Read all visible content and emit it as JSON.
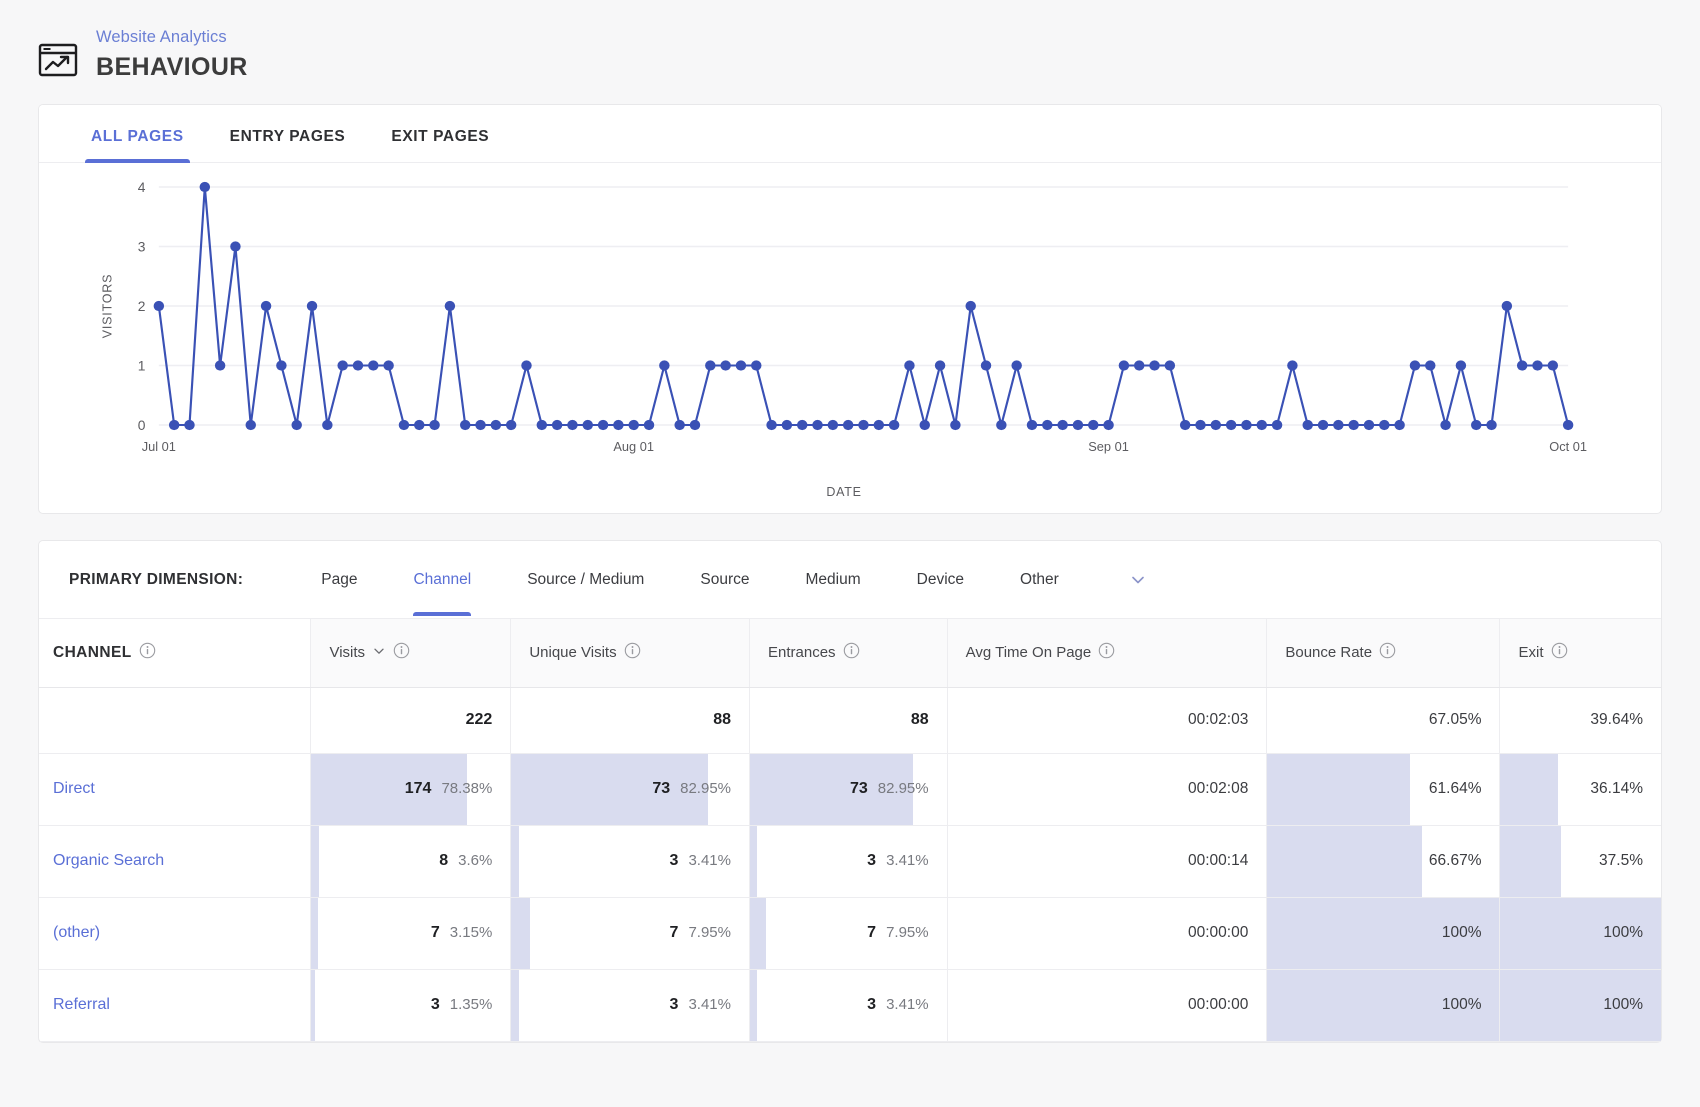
{
  "header": {
    "breadcrumb": "Website Analytics",
    "title": "BEHAVIOUR",
    "icon": "analytics-window-icon"
  },
  "tabs": [
    {
      "label": "ALL PAGES",
      "active": true
    },
    {
      "label": "ENTRY PAGES",
      "active": false
    },
    {
      "label": "EXIT PAGES",
      "active": false
    }
  ],
  "colors": {
    "accent": "#5a6fd6",
    "series": "#3a51b5",
    "fill": "#d9dcef",
    "grid": "#eeeef2",
    "text": "#3b3c40"
  },
  "chart_data": {
    "type": "line",
    "title": "",
    "xlabel": "DATE",
    "ylabel": "VISITORS",
    "ylim": [
      0,
      4
    ],
    "yticks": [
      0,
      1,
      2,
      3,
      4
    ],
    "grid": true,
    "legend": "none",
    "markers": true,
    "xtick_labels": [
      "Jul 01",
      "Aug 01",
      "Sep 01",
      "Oct 01"
    ],
    "xtick_index": [
      0,
      31,
      62,
      92
    ],
    "x": [
      "Jul 01",
      "Jul 02",
      "Jul 03",
      "Jul 04",
      "Jul 05",
      "Jul 06",
      "Jul 07",
      "Jul 08",
      "Jul 09",
      "Jul 10",
      "Jul 11",
      "Jul 12",
      "Jul 13",
      "Jul 14",
      "Jul 15",
      "Jul 16",
      "Jul 17",
      "Jul 18",
      "Jul 19",
      "Jul 20",
      "Jul 21",
      "Jul 22",
      "Jul 23",
      "Jul 24",
      "Jul 25",
      "Jul 26",
      "Jul 27",
      "Jul 28",
      "Jul 29",
      "Jul 30",
      "Jul 31",
      "Aug 01",
      "Aug 02",
      "Aug 03",
      "Aug 04",
      "Aug 05",
      "Aug 06",
      "Aug 07",
      "Aug 08",
      "Aug 09",
      "Aug 10",
      "Aug 11",
      "Aug 12",
      "Aug 13",
      "Aug 14",
      "Aug 15",
      "Aug 16",
      "Aug 17",
      "Aug 18",
      "Aug 19",
      "Aug 20",
      "Aug 21",
      "Aug 22",
      "Aug 23",
      "Aug 24",
      "Aug 25",
      "Aug 26",
      "Aug 27",
      "Aug 28",
      "Aug 29",
      "Aug 30",
      "Aug 31",
      "Sep 01",
      "Sep 02",
      "Sep 03",
      "Sep 04",
      "Sep 05",
      "Sep 06",
      "Sep 07",
      "Sep 08",
      "Sep 09",
      "Sep 10",
      "Sep 11",
      "Sep 12",
      "Sep 13",
      "Sep 14",
      "Sep 15",
      "Sep 16",
      "Sep 17",
      "Sep 18",
      "Sep 19",
      "Sep 20",
      "Sep 21",
      "Sep 22",
      "Sep 23",
      "Sep 24",
      "Sep 25",
      "Sep 26",
      "Sep 27",
      "Sep 28",
      "Sep 29",
      "Sep 30",
      "Oct 01"
    ],
    "series": [
      {
        "name": "Visitors",
        "values": [
          2,
          0,
          0,
          4,
          1,
          3,
          0,
          2,
          1,
          0,
          2,
          0,
          1,
          1,
          1,
          1,
          0,
          0,
          0,
          2,
          0,
          0,
          0,
          0,
          1,
          0,
          0,
          0,
          0,
          0,
          0,
          0,
          0,
          1,
          0,
          0,
          1,
          1,
          1,
          1,
          0,
          0,
          0,
          0,
          0,
          0,
          0,
          0,
          0,
          1,
          0,
          1,
          0,
          2,
          1,
          0,
          1,
          0,
          0,
          0,
          0,
          0,
          0,
          1,
          1,
          1,
          1,
          0,
          0,
          0,
          0,
          0,
          0,
          0,
          1,
          0,
          0,
          0,
          0,
          0,
          0,
          0,
          1,
          1,
          0,
          1,
          0,
          0,
          2,
          1,
          1,
          1,
          0
        ]
      }
    ]
  },
  "primary_dimension": {
    "label": "PRIMARY DIMENSION:",
    "options": [
      {
        "label": "Page",
        "active": false
      },
      {
        "label": "Channel",
        "active": true
      },
      {
        "label": "Source / Medium",
        "active": false
      },
      {
        "label": "Source",
        "active": false
      },
      {
        "label": "Medium",
        "active": false
      },
      {
        "label": "Device",
        "active": false
      },
      {
        "label": "Other",
        "active": false
      }
    ],
    "chevron_icon": "chevron-down-icon"
  },
  "table": {
    "columns": [
      {
        "label": "CHANNEL",
        "info": true,
        "sortable": false
      },
      {
        "label": "Visits",
        "info": true,
        "sortable": true
      },
      {
        "label": "Unique Visits",
        "info": true,
        "sortable": false
      },
      {
        "label": "Entrances",
        "info": true,
        "sortable": false
      },
      {
        "label": "Avg Time On Page",
        "info": true,
        "sortable": false
      },
      {
        "label": "Bounce Rate",
        "info": true,
        "sortable": false
      },
      {
        "label": "Exit",
        "info": true,
        "sortable": false
      }
    ],
    "totals": {
      "label": "",
      "visits": "222",
      "unique_visits": "88",
      "entrances": "88",
      "avg_time": "00:02:03",
      "bounce_rate": "67.05%",
      "exit": "39.64%"
    },
    "rows": [
      {
        "channel": "Direct",
        "visits": "174",
        "visits_pct": "78.38%",
        "visits_bar": 78.38,
        "unique": "73",
        "unique_pct": "82.95%",
        "unique_bar": 82.95,
        "entrances": "73",
        "entrances_pct": "82.95%",
        "entrances_bar": 82.95,
        "avg_time": "00:02:08",
        "bounce_rate": "61.64%",
        "bounce_bar": 61.64,
        "exit": "36.14%",
        "exit_bar": 36.14
      },
      {
        "channel": "Organic Search",
        "visits": "8",
        "visits_pct": "3.6%",
        "visits_bar": 3.6,
        "unique": "3",
        "unique_pct": "3.41%",
        "unique_bar": 3.41,
        "entrances": "3",
        "entrances_pct": "3.41%",
        "entrances_bar": 3.41,
        "avg_time": "00:00:14",
        "bounce_rate": "66.67%",
        "bounce_bar": 66.67,
        "exit": "37.5%",
        "exit_bar": 37.5
      },
      {
        "channel": "(other)",
        "visits": "7",
        "visits_pct": "3.15%",
        "visits_bar": 3.15,
        "unique": "7",
        "unique_pct": "7.95%",
        "unique_bar": 7.95,
        "entrances": "7",
        "entrances_pct": "7.95%",
        "entrances_bar": 7.95,
        "avg_time": "00:00:00",
        "bounce_rate": "100%",
        "bounce_bar": 100,
        "exit": "100%",
        "exit_bar": 100
      },
      {
        "channel": "Referral",
        "visits": "3",
        "visits_pct": "1.35%",
        "visits_bar": 1.35,
        "unique": "3",
        "unique_pct": "3.41%",
        "unique_bar": 3.41,
        "entrances": "3",
        "entrances_pct": "3.41%",
        "entrances_bar": 3.41,
        "avg_time": "00:00:00",
        "bounce_rate": "100%",
        "bounce_bar": 100,
        "exit": "100%",
        "exit_bar": 100
      }
    ]
  }
}
